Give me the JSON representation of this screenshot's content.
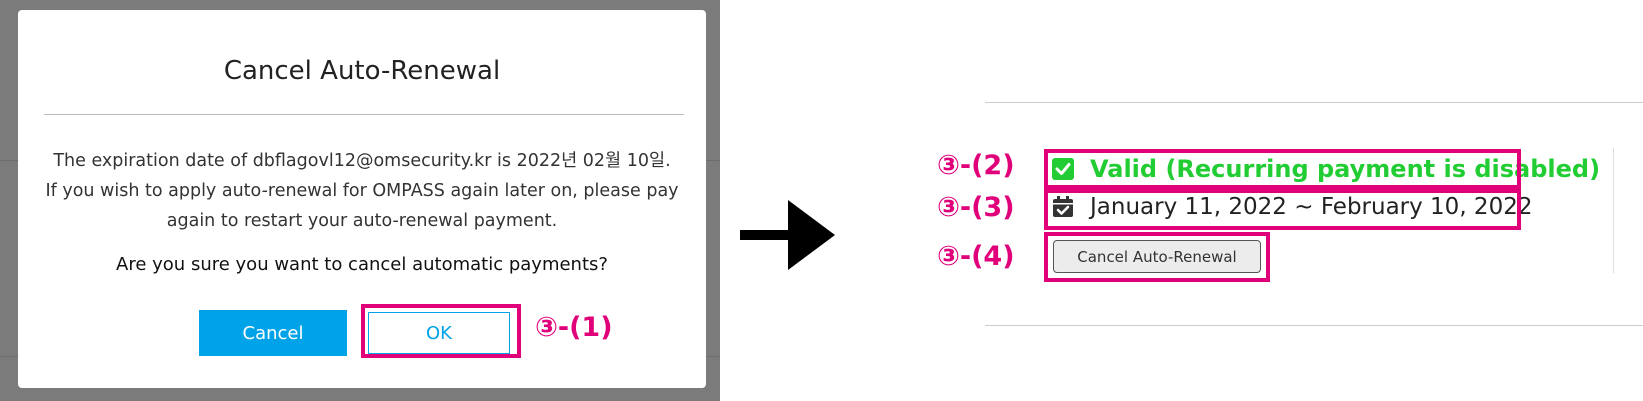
{
  "modal": {
    "title": "Cancel Auto-Renewal",
    "body_lines": [
      "The expiration date of dbflagovl12@omsecurity.kr is 2022년 02월 10일.",
      "If you wish to apply auto-renewal for OMPASS again later on, please pay",
      "again to restart your auto-renewal payment."
    ],
    "question": "Are you sure you want to cancel automatic payments?",
    "cancel_label": "Cancel",
    "ok_label": "OK"
  },
  "steps": {
    "s1": "③-(1)",
    "s2": "③-(2)",
    "s3": "③-(3)",
    "s4": "③-(4)"
  },
  "status": {
    "valid_text": "Valid (Recurring payment is disabled)",
    "valid_icon": "check-square-icon",
    "period_text": "January 11, 2022 ~ February 10, 2022",
    "period_icon": "calendar-check-icon",
    "cancel_button_label": "Cancel Auto-Renewal"
  },
  "colors": {
    "highlight": "#e0007a",
    "primary_button": "#00a3e7",
    "valid_green": "#22cc33",
    "backdrop": "#7b7b7b"
  }
}
